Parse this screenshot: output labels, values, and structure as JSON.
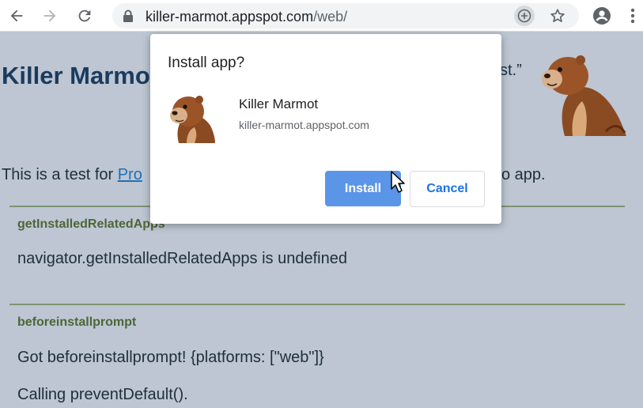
{
  "browser": {
    "url_host": "killer-marmot.appspot.com",
    "url_path": "/web/",
    "icons": {
      "back": "arrow-left-icon",
      "forward": "arrow-right-icon",
      "reload": "reload-icon",
      "lock": "lock-icon",
      "install": "install-plus-icon",
      "bookmark": "star-icon",
      "profile": "account-icon",
      "menu": "kebab-menu-icon"
    }
  },
  "page": {
    "title": "Killer Marmo",
    "quote_tail": "st.”",
    "intro_prefix": "This is a test for ",
    "intro_link": "Pro",
    "intro_tail": "o app.",
    "sections": [
      {
        "heading": "getInstalledRelatedApps",
        "lines": [
          "navigator.getInstalledRelatedApps is undefined"
        ]
      },
      {
        "heading": "beforeinstallprompt",
        "lines": [
          "Got beforeinstallprompt! {platforms: [\"web\"]}",
          "Calling preventDefault()."
        ]
      }
    ]
  },
  "dialog": {
    "title": "Install app?",
    "app_name": "Killer Marmot",
    "app_url": "killer-marmot.appspot.com",
    "install_label": "Install",
    "cancel_label": "Cancel"
  },
  "colors": {
    "page_bg": "#bdc6d2",
    "install_button": "#5b95e8",
    "cancel_text": "#1a73e8",
    "title_text": "#1b3b5e",
    "section_head": "#4e6638"
  }
}
